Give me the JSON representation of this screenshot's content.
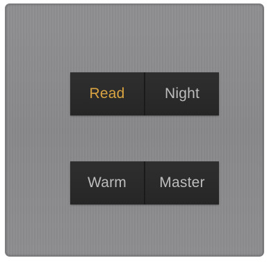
{
  "panel": {
    "rows": [
      {
        "buttons": [
          {
            "label": "Read",
            "active": true
          },
          {
            "label": "Night",
            "active": false
          }
        ]
      },
      {
        "buttons": [
          {
            "label": "Warm",
            "active": false
          },
          {
            "label": "Master",
            "active": false
          }
        ]
      }
    ]
  },
  "colors": {
    "active_text": "#d9a441",
    "inactive_text": "#bdbdbd",
    "plate": "#8c8c8e",
    "button_bg": "#2a2a2a"
  }
}
